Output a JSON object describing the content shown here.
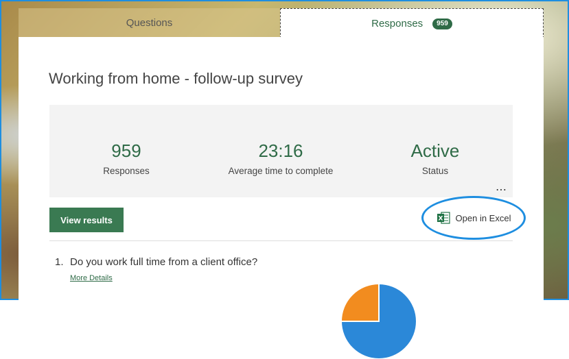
{
  "tabs": {
    "questions": {
      "label": "Questions"
    },
    "responses": {
      "label": "Responses",
      "badge": "959"
    }
  },
  "form": {
    "title": "Working from home - follow-up survey"
  },
  "stats": [
    {
      "value": "959",
      "label": "Responses"
    },
    {
      "value": "23:16",
      "label": "Average time to complete"
    },
    {
      "value": "Active",
      "label": "Status"
    }
  ],
  "actions": {
    "more_options": "…",
    "view_results": "View results",
    "open_in_excel": "Open in Excel"
  },
  "question": {
    "number": "1.",
    "text": "Do you work full time from a client office?",
    "more_details": "More Details"
  },
  "colors": {
    "accent": "#2f6b47",
    "button": "#3a7a52",
    "highlight_ring": "#1e8ee0",
    "pie_blue": "#2b88d8",
    "pie_orange": "#f28c1f"
  },
  "icons": {
    "excel": "excel-icon",
    "more": "more-options-icon"
  }
}
